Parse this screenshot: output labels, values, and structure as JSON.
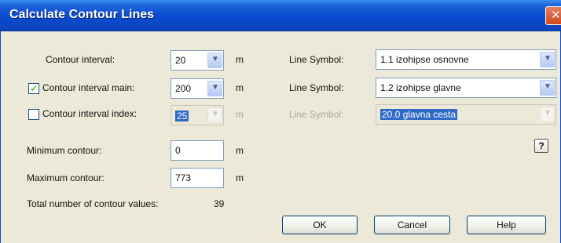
{
  "window": {
    "title": "Calculate Contour Lines",
    "close_glyph": "✕"
  },
  "contour_interval": {
    "label": "Contour interval:",
    "value": "20",
    "unit": "m"
  },
  "contour_interval_main": {
    "label": "Contour interval main:",
    "value": "200",
    "unit": "m",
    "checked": true
  },
  "contour_interval_index": {
    "label": "Contour interval index:",
    "value": "25",
    "unit": "m",
    "checked": false
  },
  "line_symbol_1": {
    "label": "Line Symbol:",
    "value": "1.1 izohipse osnovne"
  },
  "line_symbol_2": {
    "label": "Line Symbol:",
    "value": "1.2 izohipse glavne"
  },
  "line_symbol_3": {
    "label": "Line Symbol:",
    "value": "20.0 glavna cesta"
  },
  "minimum_contour": {
    "label": "Minimum contour:",
    "value": "0",
    "unit": "m"
  },
  "maximum_contour": {
    "label": "Maximum contour:",
    "value": "773",
    "unit": "m"
  },
  "total": {
    "label": "Total number of contour values:",
    "value": "39"
  },
  "buttons": {
    "ok": "OK",
    "cancel": "Cancel",
    "help": "Help",
    "question": "?"
  },
  "colors": {
    "titlebar": "#0a4ad0",
    "dialog_bg": "#ece9d8",
    "selection": "#316ac5",
    "close": "#d2471c"
  },
  "icons": {
    "dropdown": "chevron-down-icon",
    "check": "checkmark-icon",
    "close": "close-icon",
    "help": "help-icon"
  }
}
